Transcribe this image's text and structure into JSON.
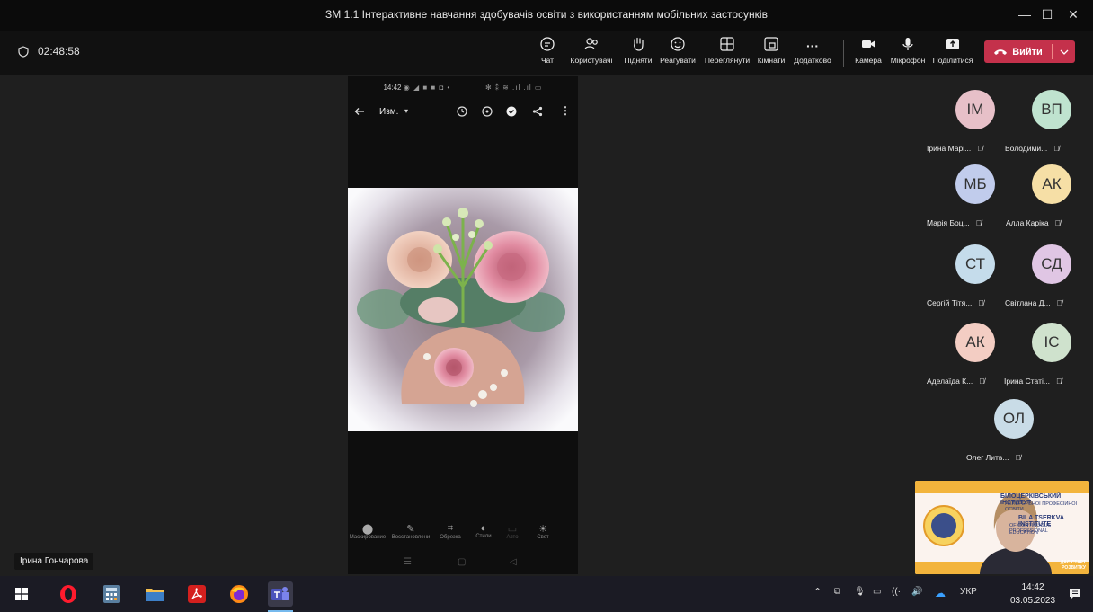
{
  "window": {
    "title": "ЗМ 1.1 Інтерактивне навчання здобувачів освіти з використанням мобільних застосунків",
    "minimize_glyph": "—",
    "maximize_glyph": "☐",
    "close_glyph": "✕"
  },
  "meeting": {
    "timer": "02:48:58",
    "tools": [
      {
        "label": "Чат",
        "icon": "chat-icon"
      },
      {
        "label": "Користувачі",
        "icon": "people-icon"
      },
      {
        "label": "Підняти",
        "icon": "raise-hand-icon"
      },
      {
        "label": "Реагувати",
        "icon": "react-icon"
      },
      {
        "label": "Переглянути",
        "icon": "view-icon"
      },
      {
        "label": "Кімнати",
        "icon": "rooms-icon"
      },
      {
        "label": "Додатково",
        "icon": "more-icon"
      },
      {
        "label": "Камера",
        "icon": "camera-icon"
      },
      {
        "label": "Мікрофон",
        "icon": "microphone-icon"
      },
      {
        "label": "Поділитися",
        "icon": "share-icon"
      }
    ],
    "leave_label": "Вийти",
    "leave_color": "#c4314b"
  },
  "shared_phone": {
    "status_time": "14:42",
    "mode_label": "Изм.",
    "edit_tools": [
      "Маскирование",
      "Восстановлени",
      "Обрезка",
      "Стили",
      "Авто",
      "Свет"
    ]
  },
  "presenter_name": "Ірина Гончарова",
  "participants": [
    {
      "initials": "ІМ",
      "name": "Ірина Марі...",
      "color": "#e7c0c8"
    },
    {
      "initials": "ВП",
      "name": "Володими...",
      "color": "#bfe3cf"
    },
    {
      "initials": "МБ",
      "name": "Марія Боц...",
      "color": "#c1ccec"
    },
    {
      "initials": "АК",
      "name": "Алла Каріка",
      "color": "#f6dfa6"
    },
    {
      "initials": "СТ",
      "name": "Сергій Тітя...",
      "color": "#c5dceb"
    },
    {
      "initials": "СД",
      "name": "Світлана Д...",
      "color": "#e0c6e4"
    },
    {
      "initials": "АК",
      "name": "Аделаїда К...",
      "color": "#f3cdc3"
    },
    {
      "initials": "ІС",
      "name": "Ірина Статі...",
      "color": "#cfe2cd"
    },
    {
      "initials": "ОЛ",
      "name": "Олег Литв...",
      "color": "#c9dce7"
    }
  ],
  "self_view": {
    "banner_line1": "БІЛОЦЕРКІВСЬКИЙ ІНСТИТУТ",
    "banner_line2": "НЕПЕРЕРВНОЇ ПРОФЕСІЙНОЇ ОСВІТИ",
    "banner_line3": "BILA TSERKVA INSTITUTE",
    "banner_line4": "OF CONTINUOUS PROFESSIONAL",
    "banner_line5": "EDUCATION",
    "banner_corner": "ДАЄ СТАРТ РОЗВИТКУ"
  },
  "taskbar": {
    "language": "УКР",
    "time": "14:42",
    "date": "03.05.2023"
  }
}
